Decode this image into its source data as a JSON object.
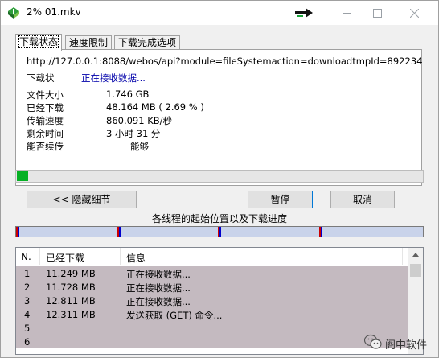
{
  "window": {
    "title": "2% 01.mkv",
    "minimize_icon": "minimize-icon",
    "maximize_icon": "maximize-icon",
    "close_icon": "close-icon"
  },
  "tabs": [
    {
      "label": "下载状态",
      "active": true
    },
    {
      "label": "速度限制",
      "active": false
    },
    {
      "label": "下载完成选项",
      "active": false
    }
  ],
  "status": {
    "url": "http://127.0.0.1:8088/webos/api?module=fileSystemaction=downloadtmpId=892234",
    "state_label": "下载状",
    "state_value": "正在接收数据...",
    "fields": [
      {
        "label": "文件大小",
        "value": "1.746  GB"
      },
      {
        "label": "已经下载",
        "value": "48.164  MB  ( 2.69 % )"
      },
      {
        "label": "传输速度",
        "value": "860.091  KB/秒"
      },
      {
        "label": "剩余时间",
        "value": "3 小时 31 分"
      },
      {
        "label": "能否续传",
        "value": "能够"
      }
    ]
  },
  "progress": {
    "percent": 2.69,
    "color": "#06b025"
  },
  "buttons": {
    "hide_details": "<< 隐藏细节",
    "pause": "暂停",
    "cancel": "取消"
  },
  "threads": {
    "label": "各线程的起始位置以及下载进度",
    "start_positions": [
      0.0,
      0.25,
      0.5,
      0.75
    ],
    "marker_colors": [
      "#cc0000",
      "#0000cc"
    ]
  },
  "connections": {
    "columns": [
      "N.",
      "已经下载",
      "信息"
    ],
    "rows": [
      {
        "n": "1",
        "downloaded": "11.249  MB",
        "info": "正在接收数据..."
      },
      {
        "n": "2",
        "downloaded": "11.728  MB",
        "info": "正在接收数据..."
      },
      {
        "n": "3",
        "downloaded": "12.811  MB",
        "info": "正在接收数据..."
      },
      {
        "n": "4",
        "downloaded": "12.311  MB",
        "info": "发送获取 (GET) 命令..."
      },
      {
        "n": "5",
        "downloaded": "",
        "info": ""
      },
      {
        "n": "6",
        "downloaded": "",
        "info": ""
      }
    ],
    "row_color": "#c4bac0"
  },
  "watermark": {
    "text": "阁中软件"
  }
}
